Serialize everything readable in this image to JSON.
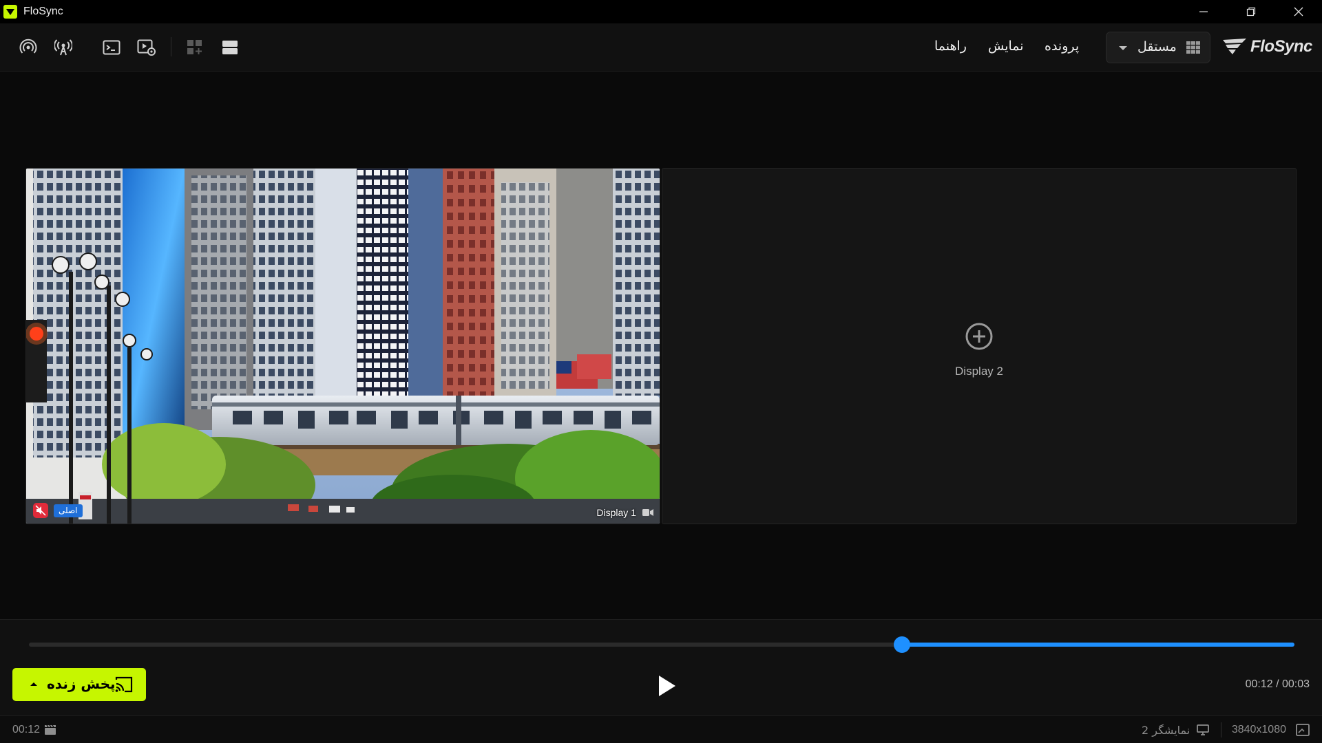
{
  "window": {
    "title": "FloSync"
  },
  "toolbar": {
    "menu_file": "پرونده",
    "menu_view": "نمایش",
    "menu_help": "راهنما",
    "mode_label": "مستقل",
    "brand": "FloSync",
    "icons": [
      "broadcast-icon",
      "antenna-icon",
      "terminal-icon",
      "media-settings-icon",
      "grid-layout-icon",
      "rows-layout-icon"
    ]
  },
  "stage": {
    "display1": {
      "label": "Display 1",
      "badge": "اصلی",
      "muted": true
    },
    "display2": {
      "label": "Display 2"
    }
  },
  "controls": {
    "progress": 0.69,
    "live_button": "پخش زنده",
    "time": "00:12 / 00:03"
  },
  "status": {
    "duration": "00:12",
    "displays": "2 نمایشگر",
    "resolution": "3840x1080"
  },
  "colors": {
    "accent": "#1e90ff",
    "live": "#c6f600",
    "mute": "#e02b3a",
    "badge": "#1f6fd8"
  }
}
